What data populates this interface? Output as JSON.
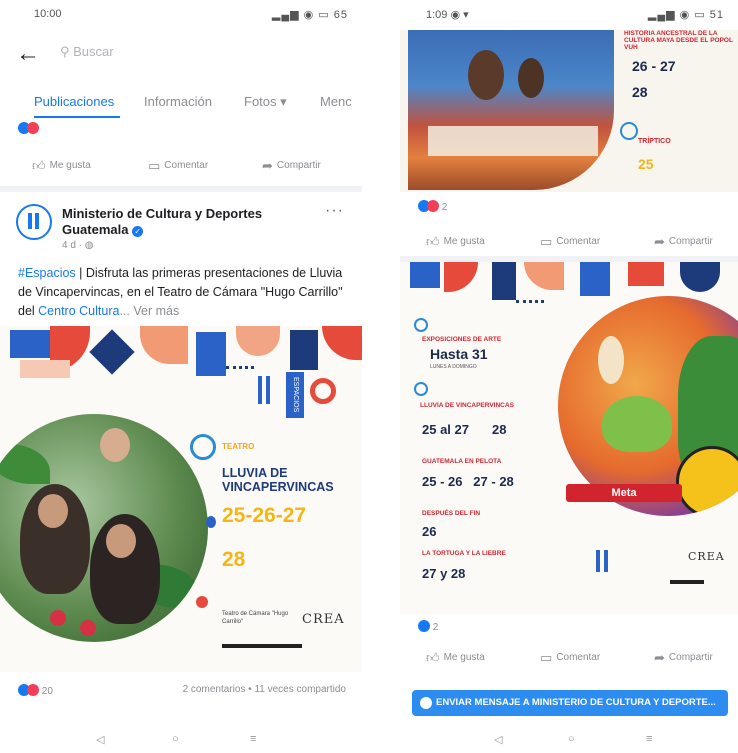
{
  "left": {
    "status": {
      "time": "10:00",
      "system": "65"
    },
    "search_placeholder": "Buscar",
    "tabs": [
      "Publicaciones",
      "Información",
      "Fotos",
      "Menc"
    ],
    "actions": [
      "Me gusta",
      "Comentar",
      "Compartir"
    ],
    "post": {
      "page_name": "Ministerio de Cultura y Deportes Guatemala",
      "time": "4 d",
      "hashtag": "#Espacios",
      "text_1": " | Disfruta las primeras presentaciones de Lluvia de Vincapervincas, en el Teatro de Cámara \"Hugo Carrillo\" del ",
      "link": "Centro Cultura",
      "more": "... Ver más",
      "poster": {
        "category": "TEATRO",
        "title": "LLUVIA DE VINCAPERVINCAS",
        "dates_1": "25-26-27",
        "dates_2": "28",
        "venue": "Teatro de Cámara \"Hugo Carrillo\"",
        "crea": "CREA",
        "espacios": "ESPACIOS"
      },
      "reactions_count": "20",
      "stats": "2 comentarios • 11 veces compartido"
    }
  },
  "right": {
    "status": {
      "time": "1:09",
      "system": "51"
    },
    "poster1": {
      "heading": "HISTORIA ANCESTRAL DE LA CULTURA MAYA DESDE EL POPOL VUH",
      "date_a": "26 - 27",
      "date_b": "28",
      "section": "TRÍPTICO",
      "date_c": "25"
    },
    "reactions_1": "2",
    "actions": [
      "Me gusta",
      "Comentar",
      "Compartir"
    ],
    "poster2": {
      "expo_label": "EXPOSICIONES DE ARTE",
      "expo_date": "Hasta 31",
      "expo_sub": "LUNES A DOMINGO",
      "lluvia_label": "LLUVIA DE VINCAPERVINCAS",
      "lluvia_date": "25 al 27",
      "lluvia_date_b": "28",
      "pelota_label": "GUATEMALA EN PELOTA",
      "pelota_date": "25 - 26   27 - 28",
      "fin_label": "DESPUÉS DEL FIN",
      "fin_date": "26",
      "tortuga_label": "LA TORTUGA Y LA LIEBRE",
      "tortuga_date": "27 y 28",
      "meta": "Meta",
      "crea": "CREA"
    },
    "reactions_2": "2",
    "send_message": "ENVIAR MENSAJE A MINISTERIO DE CULTURA Y DEPORTE..."
  },
  "colors": {
    "facebook_blue": "#1877f2",
    "poster_navy": "#1d3a7a",
    "poster_yellow": "#f3b616",
    "poster_red": "#d2242f"
  }
}
